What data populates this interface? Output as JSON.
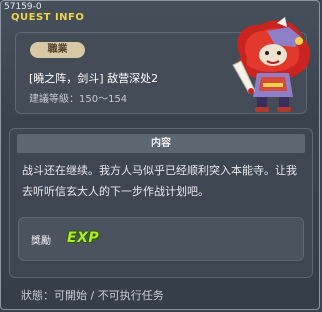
{
  "header": {
    "quest_id": "57159-0",
    "quest_info_label": "QUEST INFO"
  },
  "info": {
    "job_badge": "職業",
    "title": "[曉之阵，剑斗] 敌营深处2",
    "level_requirement": "建議等級：150～154"
  },
  "npc": {
    "icon": "red-lion-warrior-npc"
  },
  "content": {
    "header": "内容",
    "text": "战斗还在继续。我方人马似乎已经顺利突入本能寺。让我去听听信玄大人的下一步作战计划吧。"
  },
  "reward": {
    "label": "獎勵",
    "exp_text": "EXP"
  },
  "status": {
    "text": "狀態：可開始 / 不可执行任务"
  },
  "colors": {
    "title_yellow": "#f2d348",
    "exp_green": "#b3ea2a",
    "panel_bg": "#3b4450"
  }
}
